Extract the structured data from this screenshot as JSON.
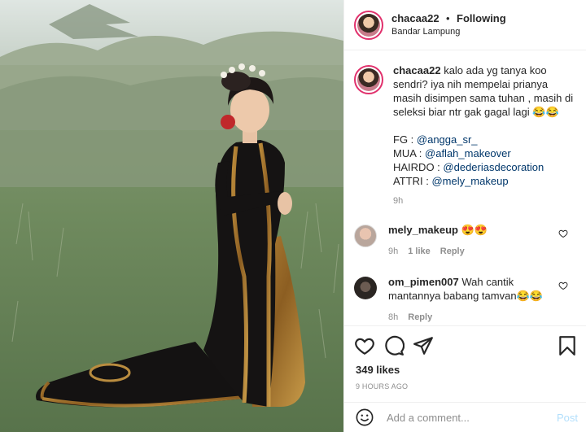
{
  "header": {
    "username": "chacaa22",
    "separator": "•",
    "follow_label": "Following",
    "location": "Bandar Lampung"
  },
  "caption": {
    "username": "chacaa22",
    "text": "kalo ada yg tanya koo sendri? iya nih mempelai prianya masih disimpen sama tuhan , masih di seleksi biar ntr gak gagal lagi 😂😂",
    "credits": [
      {
        "label": "FG : ",
        "handle": "@angga_sr_"
      },
      {
        "label": "MUA : ",
        "handle": "@aflah_makeover"
      },
      {
        "label": "HAIRDO : ",
        "handle": "@dederiasdecoration"
      },
      {
        "label": "ATTRI : ",
        "handle": "@mely_makeup"
      }
    ],
    "time": "9h"
  },
  "comments": [
    {
      "username": "mely_makeup",
      "text": "😍😍",
      "time": "9h",
      "likes": "1 like",
      "reply": "Reply"
    },
    {
      "username": "om_pimen007",
      "text": "Wah cantik mantannya babang tamvan😂😂",
      "time": "8h",
      "reply": "Reply"
    }
  ],
  "actions": {
    "icons": [
      "heart-icon",
      "comment-icon",
      "share-icon",
      "bookmark-icon"
    ],
    "likes": "349 likes",
    "posted": "9 HOURS AGO"
  },
  "add_comment": {
    "placeholder": "Add a comment...",
    "post_label": "Post"
  },
  "colors": {
    "link": "#00376b",
    "muted": "#8e8e8e",
    "post_disabled": "#b2dffc",
    "story_ring": "#e1306c"
  }
}
